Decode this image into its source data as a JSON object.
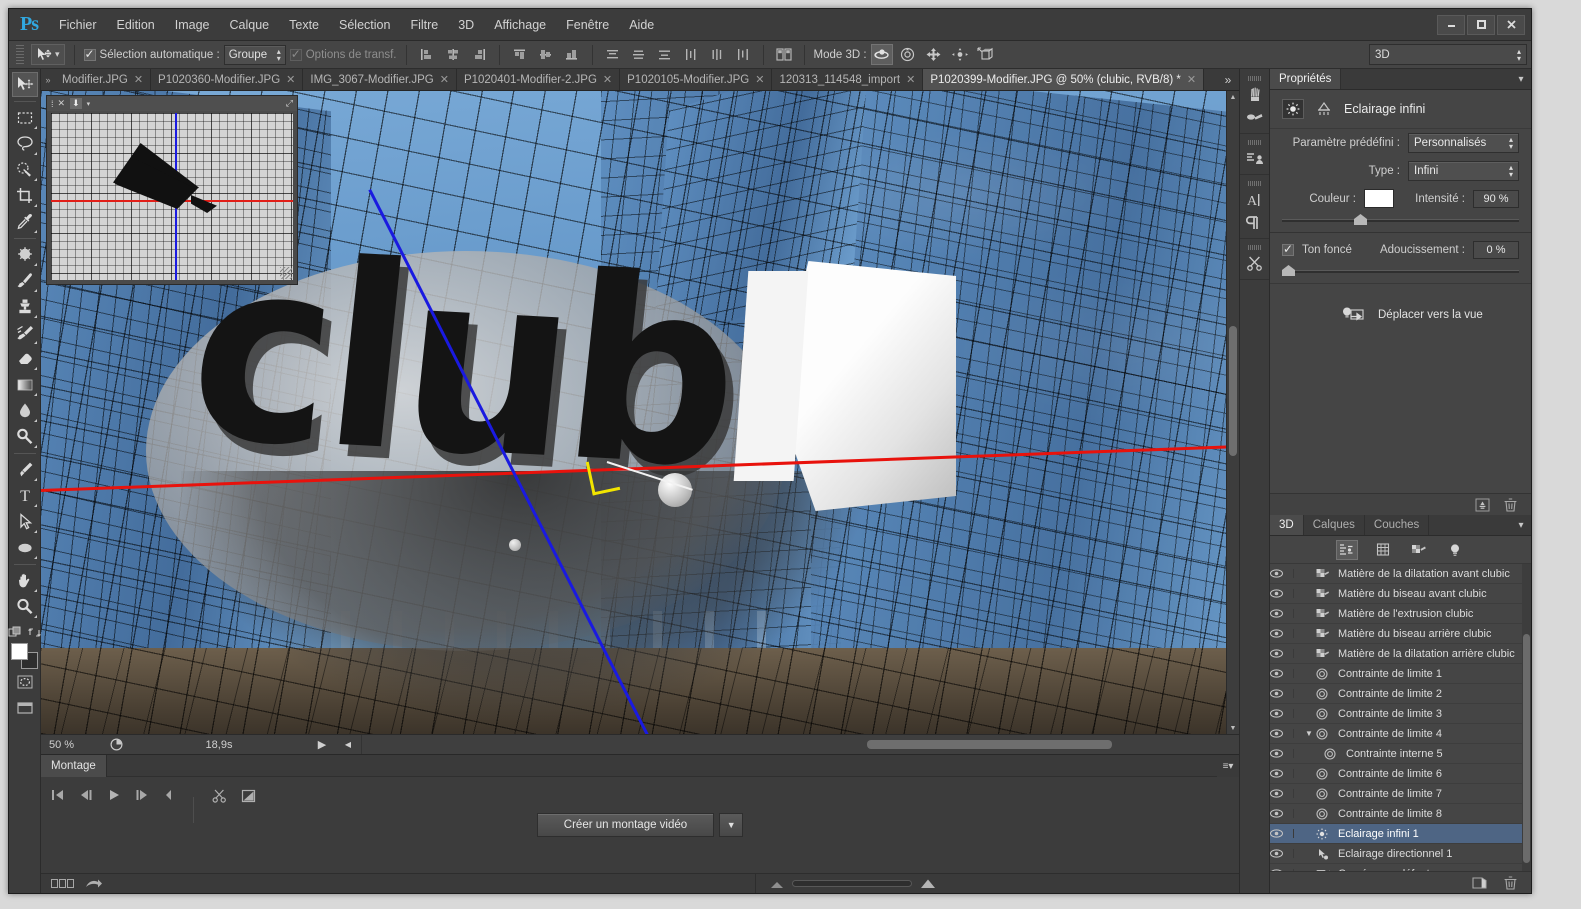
{
  "app": {
    "logo": "Ps"
  },
  "menus": [
    "Fichier",
    "Edition",
    "Image",
    "Calque",
    "Texte",
    "Sélection",
    "Filtre",
    "3D",
    "Affichage",
    "Fenêtre",
    "Aide"
  ],
  "window_controls": {
    "minimize": "—",
    "maximize": "❐",
    "close": "✕"
  },
  "options_bar": {
    "auto_select_label": "Sélection automatique :",
    "auto_select_checked": true,
    "group_value": "Groupe",
    "transform_options_label": "Options de transf.",
    "transform_options_checked": true,
    "mode3d_label": "Mode 3D :",
    "workspace_value": "3D"
  },
  "tabs": [
    {
      "label": "Modifier.JPG",
      "close": "✕",
      "active": false
    },
    {
      "label": "P1020360-Modifier.JPG",
      "close": "✕",
      "active": false
    },
    {
      "label": "IMG_3067-Modifier.JPG",
      "close": "✕",
      "active": false
    },
    {
      "label": "P1020401-Modifier-2.JPG",
      "close": "✕",
      "active": false
    },
    {
      "label": "P1020105-Modifier.JPG",
      "close": "✕",
      "active": false
    },
    {
      "label": "120313_114548_import",
      "close": "✕",
      "active": false
    },
    {
      "label": "P1020399-Modifier.JPG @ 50% (clubic, RVB/8) *",
      "close": "✕",
      "active": true
    }
  ],
  "tab_overflow": "»",
  "canvas": {
    "artwork_text": "clubic"
  },
  "status_bar": {
    "zoom": "50 %",
    "time": "18,9s"
  },
  "timeline": {
    "tab_label": "Montage",
    "create_button": "Créer un montage vidéo",
    "dropdown_arrow": "▼"
  },
  "properties": {
    "panel_tab": "Propriétés",
    "title": "Eclairage infini",
    "preset_label": "Paramètre prédéfini :",
    "preset_value": "Personnalisés",
    "type_label": "Type :",
    "type_value": "Infini",
    "color_label": "Couleur :",
    "color_value": "#ffffff",
    "intensity_label": "Intensité :",
    "intensity_value": "90 %",
    "shadow_label": "Ton foncé",
    "shadow_checked": true,
    "softness_label": "Adoucissement :",
    "softness_value": "0 %",
    "move_to_view": "Déplacer vers la vue"
  },
  "panel_tabs": [
    {
      "label": "3D",
      "active": true
    },
    {
      "label": "Calques",
      "active": false
    },
    {
      "label": "Couches",
      "active": false
    }
  ],
  "scene_items": [
    {
      "label": "Matière de la dilatation avant clubic",
      "icon": "material-icon",
      "indent": 0,
      "selected": false,
      "disclosure": ""
    },
    {
      "label": "Matière du biseau avant clubic",
      "icon": "material-icon",
      "indent": 0,
      "selected": false,
      "disclosure": ""
    },
    {
      "label": "Matière de l'extrusion clubic",
      "icon": "material-icon",
      "indent": 0,
      "selected": false,
      "disclosure": ""
    },
    {
      "label": "Matière du biseau arrière clubic",
      "icon": "material-icon",
      "indent": 0,
      "selected": false,
      "disclosure": ""
    },
    {
      "label": "Matière de la dilatation arrière clubic",
      "icon": "material-icon",
      "indent": 0,
      "selected": false,
      "disclosure": ""
    },
    {
      "label": "Contrainte de limite 1",
      "icon": "constraint-icon",
      "indent": 0,
      "selected": false,
      "disclosure": ""
    },
    {
      "label": "Contrainte de limite 2",
      "icon": "constraint-icon",
      "indent": 0,
      "selected": false,
      "disclosure": ""
    },
    {
      "label": "Contrainte de limite 3",
      "icon": "constraint-icon",
      "indent": 0,
      "selected": false,
      "disclosure": ""
    },
    {
      "label": "Contrainte de limite 4",
      "icon": "constraint-icon",
      "indent": 0,
      "selected": false,
      "disclosure": "▼"
    },
    {
      "label": "Contrainte interne 5",
      "icon": "constraint-icon",
      "indent": 1,
      "selected": false,
      "disclosure": ""
    },
    {
      "label": "Contrainte de limite 6",
      "icon": "constraint-icon",
      "indent": 0,
      "selected": false,
      "disclosure": ""
    },
    {
      "label": "Contrainte de limite 7",
      "icon": "constraint-icon",
      "indent": 0,
      "selected": false,
      "disclosure": ""
    },
    {
      "label": "Contrainte de limite 8",
      "icon": "constraint-icon",
      "indent": 0,
      "selected": false,
      "disclosure": ""
    },
    {
      "label": "Eclairage infini 1",
      "icon": "infinite-light-icon",
      "indent": 0,
      "selected": true,
      "disclosure": ""
    },
    {
      "label": "Eclairage directionnel 1",
      "icon": "spot-light-icon",
      "indent": 0,
      "selected": false,
      "disclosure": ""
    },
    {
      "label": "Caméra par défaut",
      "icon": "camera-icon",
      "indent": 0,
      "selected": false,
      "disclosure": ""
    }
  ],
  "tools": [
    "move-tool",
    "rectangular-marquee-tool",
    "lasso-tool",
    "quick-selection-tool",
    "crop-tool",
    "eyedropper-tool",
    "spot-healing-brush-tool",
    "brush-tool",
    "clone-stamp-tool",
    "history-brush-tool",
    "eraser-tool",
    "gradient-tool",
    "blur-tool",
    "dodge-tool",
    "pen-tool",
    "type-tool",
    "path-selection-tool",
    "ellipse-shape-tool",
    "hand-tool",
    "zoom-tool"
  ],
  "colors": {
    "accent": "#4e6584",
    "panel_bg": "#454545",
    "chrome_bg": "#3c3c3c",
    "logo_blue": "#31a8e0",
    "axis_red": "#e8120c",
    "axis_blue": "#1a1ae0",
    "axis_yellow": "#f2e500",
    "foreground_swatch": "#ffffff",
    "background_swatch": "#2e2e2e"
  }
}
